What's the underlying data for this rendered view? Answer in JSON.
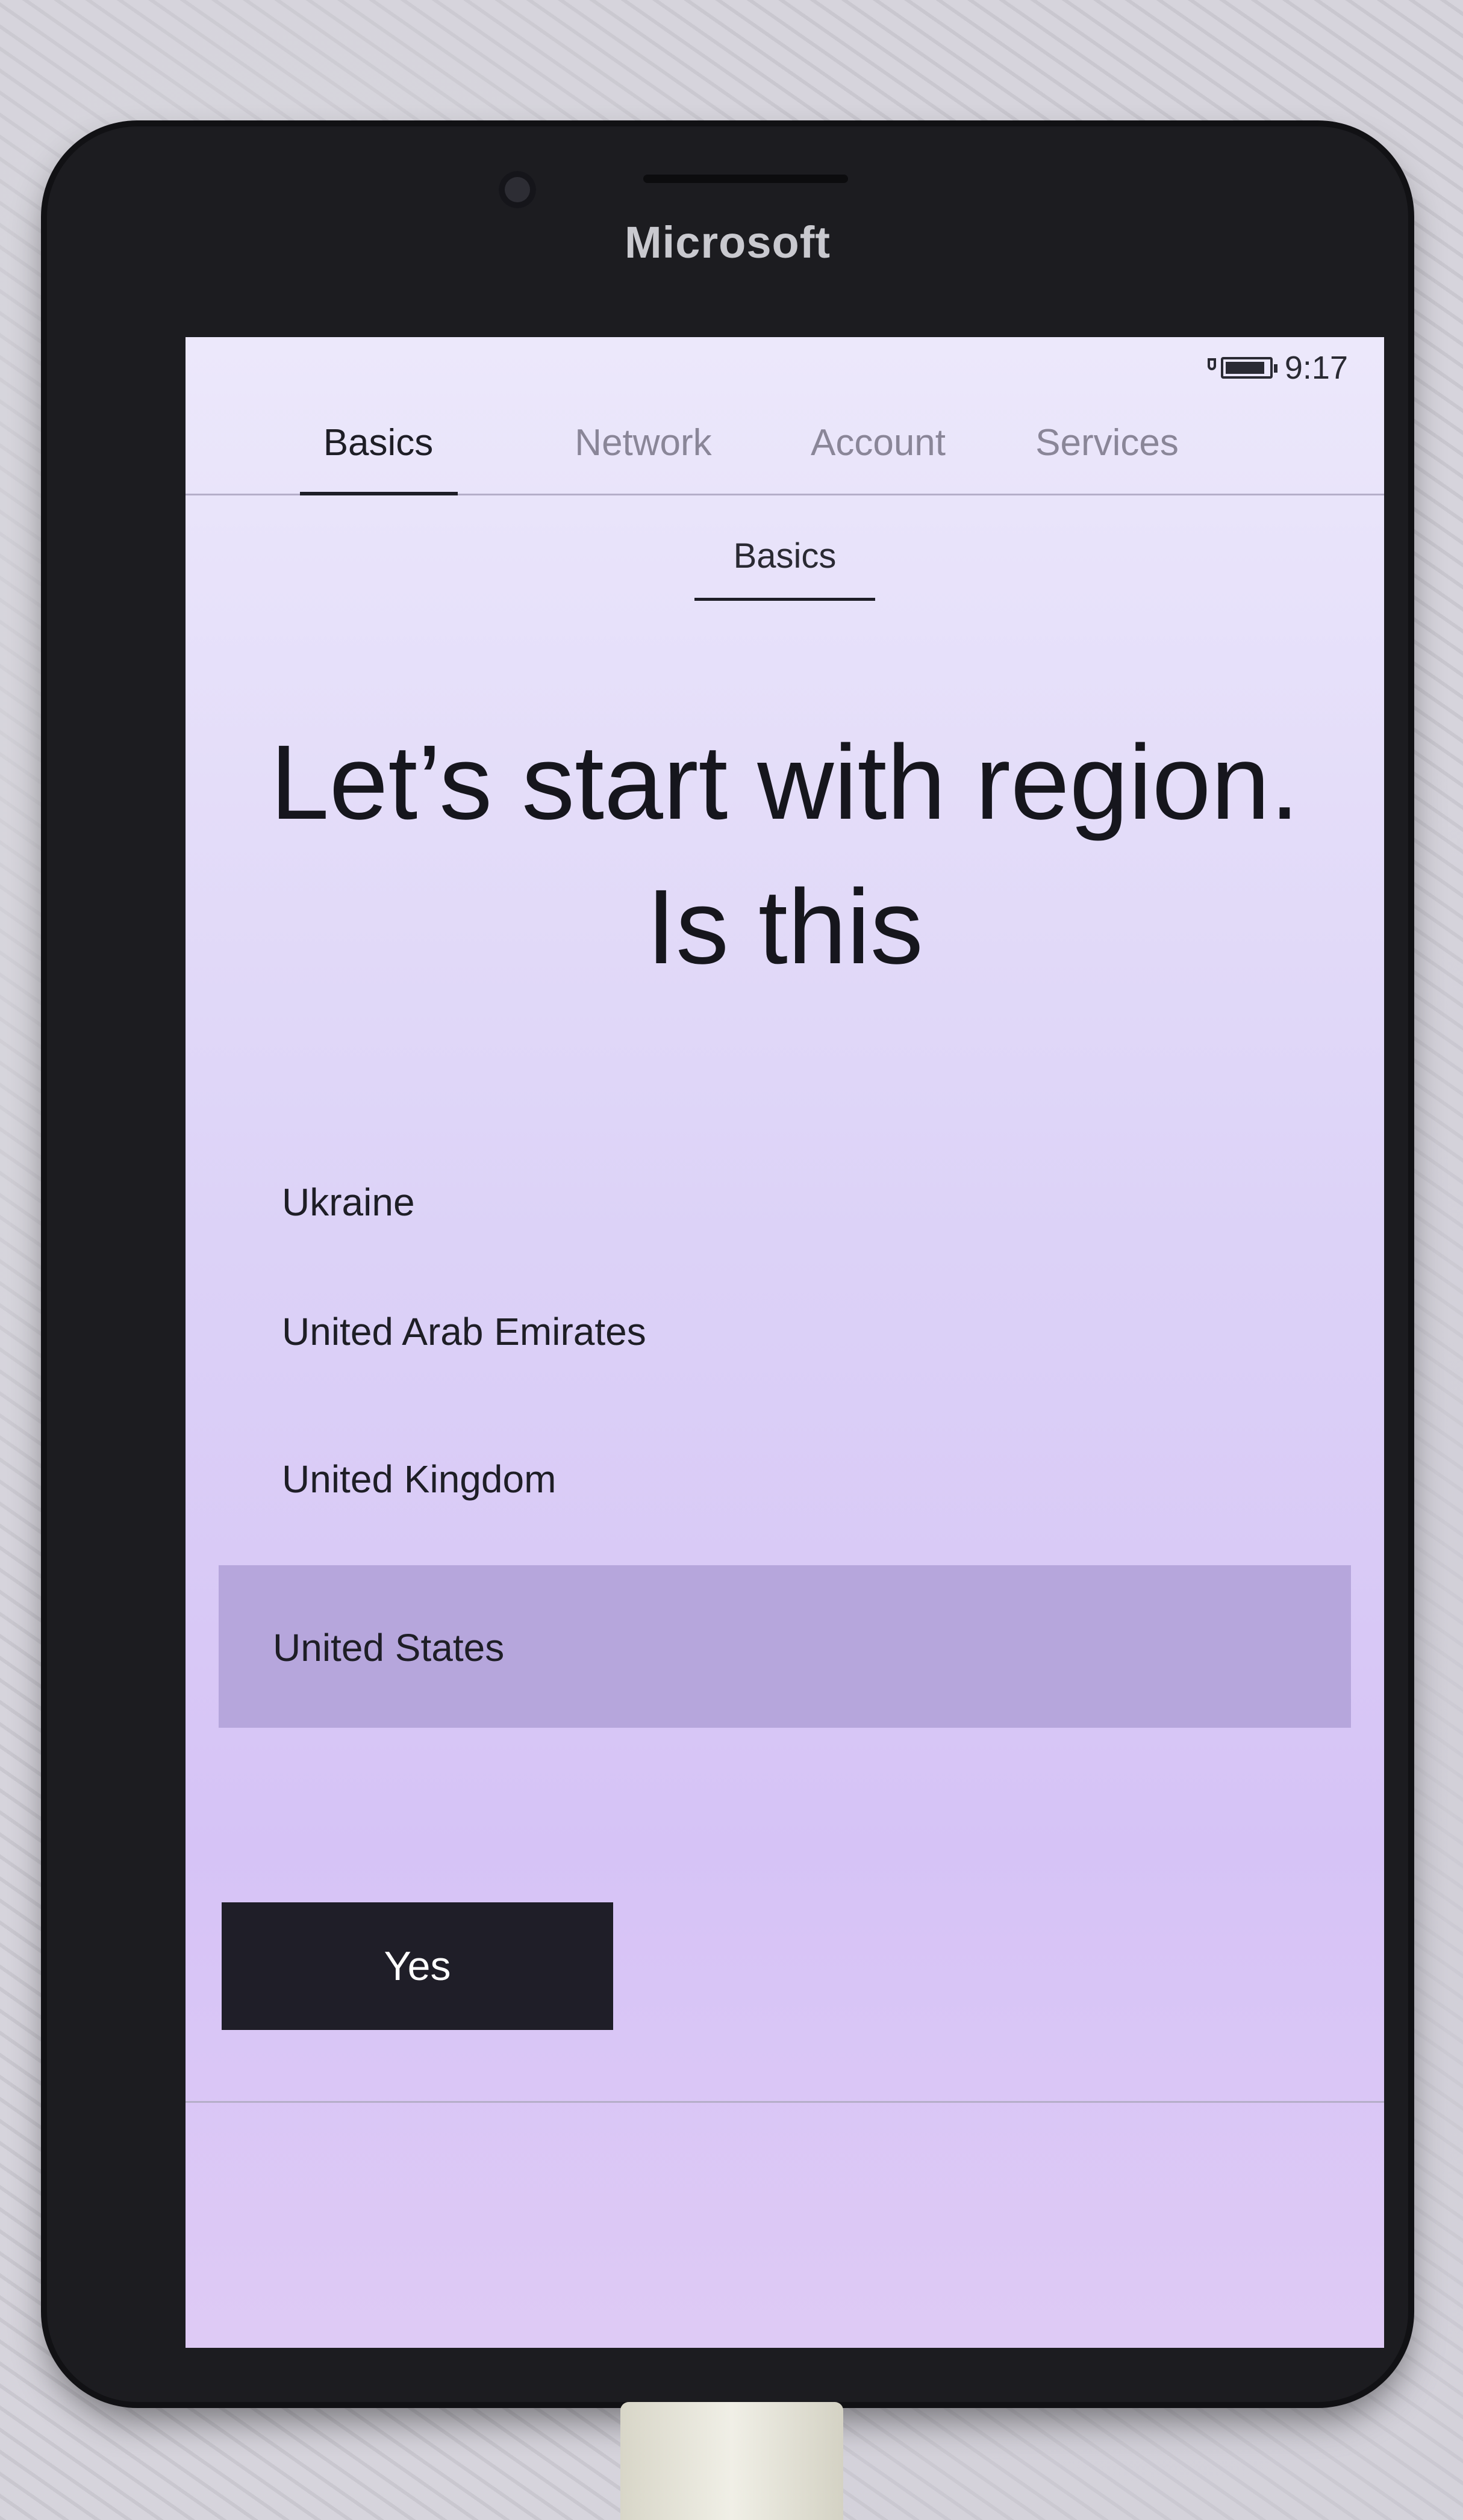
{
  "device": {
    "brand": "Microsoft"
  },
  "status_bar": {
    "time": "9:17",
    "icons": [
      "plug-icon",
      "battery-icon"
    ]
  },
  "tabs": [
    {
      "label": "Basics",
      "active": true
    },
    {
      "label": "Network",
      "active": false
    },
    {
      "label": "Account",
      "active": false
    },
    {
      "label": "Services",
      "active": false
    }
  ],
  "subtab": {
    "label": "Basics"
  },
  "headline": "Let’s start with region. Is this",
  "regions": {
    "items": [
      "Ukraine",
      "United Arab Emirates",
      "United Kingdom"
    ],
    "selected": "United States"
  },
  "actions": {
    "yes_label": "Yes"
  },
  "colors": {
    "accent_selection": "#b6a6dc",
    "button_bg": "#1f1e28",
    "screen_bg": "#e4dcf8"
  }
}
